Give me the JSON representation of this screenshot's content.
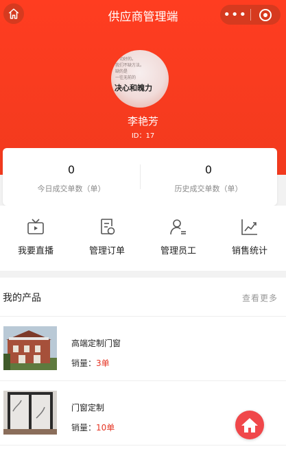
{
  "app": {
    "title": "供应商管理端"
  },
  "profile": {
    "name": "李艳芳",
    "id_text": "ID：17",
    "avatar_lines": [
      "一切好的。",
      "我们不缺方法。",
      "缺的是",
      "一往无前的"
    ],
    "avatar_big_text": "决心和魄力"
  },
  "stats": [
    {
      "value": "0",
      "label": "今日成交单数（单）"
    },
    {
      "value": "0",
      "label": "历史成交单数（单）"
    }
  ],
  "menu": [
    {
      "label": "我要直播",
      "icon": "tv-icon"
    },
    {
      "label": "管理订单",
      "icon": "order-icon"
    },
    {
      "label": "管理员工",
      "icon": "staff-icon"
    },
    {
      "label": "销售统计",
      "icon": "chart-icon"
    }
  ],
  "products": {
    "title": "我的产品",
    "more": "查看更多",
    "items": [
      {
        "name": "高端定制门窗",
        "sales_label": "销量：",
        "sales_value": "3单"
      },
      {
        "name": "门窗定制",
        "sales_label": "销量：",
        "sales_value": "10单"
      }
    ]
  },
  "colors": {
    "brand": "#f23a1e",
    "accent_red": "#e53423",
    "fab": "#f0474a"
  }
}
